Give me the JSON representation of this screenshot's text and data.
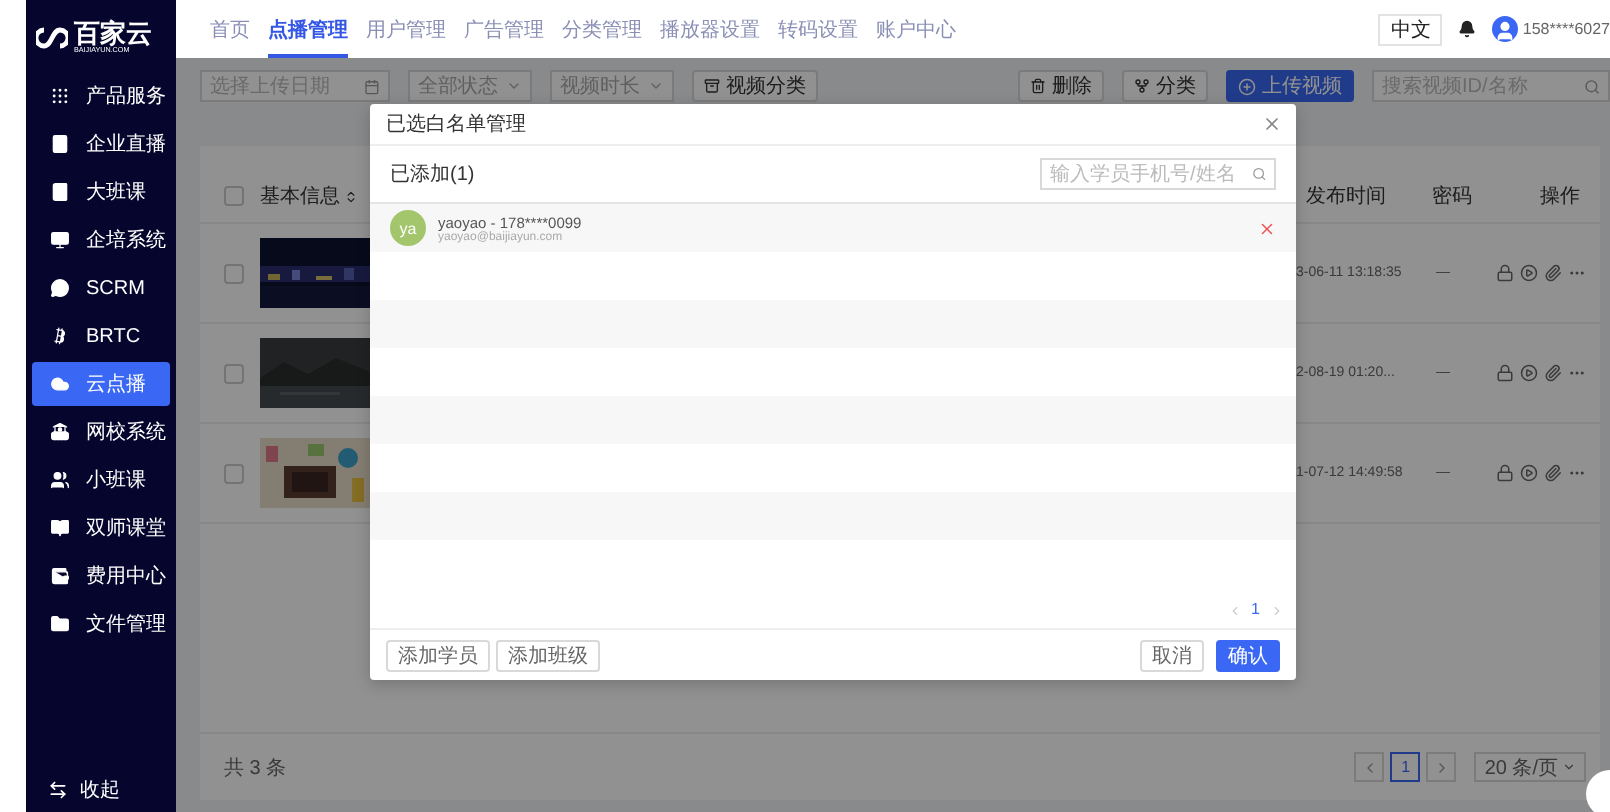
{
  "header": {
    "tabs": [
      {
        "label": "首页",
        "selected": false
      },
      {
        "label": "点播管理",
        "selected": true
      },
      {
        "label": "用户管理",
        "selected": false
      },
      {
        "label": "广告管理",
        "selected": false
      },
      {
        "label": "分类管理",
        "selected": false
      },
      {
        "label": "播放器设置",
        "selected": false
      },
      {
        "label": "转码设置",
        "selected": false
      },
      {
        "label": "账户中心",
        "selected": false
      }
    ],
    "language": "中文",
    "user": "158****6027"
  },
  "sidebar": {
    "logo": {
      "name": "百家云",
      "domain": "BAIJIAYUN.COM"
    },
    "items": [
      {
        "label": "产品服务",
        "selected": false
      },
      {
        "label": "企业直播",
        "selected": false
      },
      {
        "label": "大班课",
        "selected": false
      },
      {
        "label": "企培系统",
        "selected": false
      },
      {
        "label": "SCRM",
        "selected": false
      },
      {
        "label": "BRTC",
        "selected": false
      },
      {
        "label": "云点播",
        "selected": true
      },
      {
        "label": "网校系统",
        "selected": false
      },
      {
        "label": "小班课",
        "selected": false
      },
      {
        "label": "双师课堂",
        "selected": false
      },
      {
        "label": "费用中心",
        "selected": false
      },
      {
        "label": "文件管理",
        "selected": false
      }
    ],
    "collapse": "收起"
  },
  "toolbar": {
    "date_placeholder": "选择上传日期",
    "status": "全部状态",
    "duration": "视频时长",
    "category": "视频分类",
    "delete": "删除",
    "classify": "分类",
    "upload": "上传视频",
    "search_placeholder": "搜索视频ID/名称"
  },
  "table": {
    "select_all_checked": false,
    "columns": [
      "基本信息",
      "发布时间",
      "密码",
      "操作"
    ],
    "rows": [
      {
        "checked": false,
        "published": "3-06-11 13:18:35",
        "password": "—"
      },
      {
        "checked": false,
        "published": "2-08-19 01:20...",
        "password": "—"
      },
      {
        "checked": false,
        "published": "1-07-12 14:49:58",
        "password": "—"
      }
    ]
  },
  "footer": {
    "total": "共 3 条",
    "pages": [
      {
        "label": "1",
        "selected": true
      }
    ],
    "page_size": "20 条/页"
  },
  "modal": {
    "title": "已选白名单管理",
    "added": "已添加(1)",
    "search_placeholder": "输入学员手机号/姓名",
    "members": [
      {
        "avatar": "ya",
        "name": "yaoyao - 178****0099",
        "email": "yaoyao@baijiayun.com"
      }
    ],
    "pages": [
      {
        "label": "1",
        "selected": true
      }
    ],
    "add_buttons": [
      "添加学员",
      "添加班级"
    ],
    "cancel": "取消",
    "confirm": "确认"
  }
}
